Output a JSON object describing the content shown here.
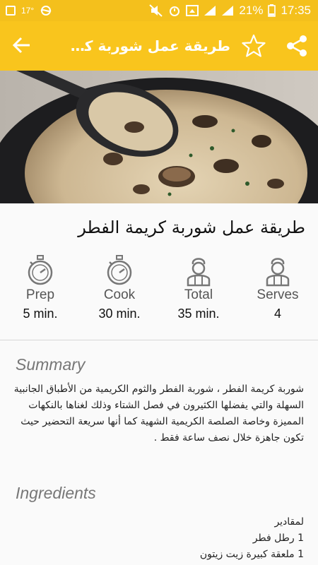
{
  "status_bar": {
    "weather_temp": "17°",
    "battery": "21%",
    "time": "17:35"
  },
  "toolbar": {
    "title": "طريقة عمل شوربة كريمة الفطر",
    "back_icon": "arrow-back-icon",
    "favorite_icon": "star-outline-icon",
    "share_icon": "share-icon"
  },
  "recipe": {
    "title": "طريقة عمل شوربة كريمة الفطر",
    "stats": [
      {
        "label": "Prep",
        "value": "5 min.",
        "icon": "stopwatch-icon"
      },
      {
        "label": "Cook",
        "value": "30 min.",
        "icon": "stopwatch-icon"
      },
      {
        "label": "Total",
        "value": "35 min.",
        "icon": "chef-icon"
      },
      {
        "label": "Serves",
        "value": "4",
        "icon": "chef-icon"
      }
    ],
    "summary_heading": "Summary",
    "summary_text": "شوربة كريمة الفطر ، شوربة الفطر والثوم الكريمية من الأطباق الجانبية السهلة والتي يفضلها الكثيرون في فصل الشتاء وذلك لغناها بالنكهات المميزة وخاصة الصلصة الكريمية الشهية كما أنها سريعة التحضير حيث تكون جاهزة خلال نصف ساعة فقط .",
    "ingredients_heading": "Ingredients",
    "ingredients": [
      "لمقادير",
      "1 رطل فطر",
      "1 ملعقة كبيرة زيت زيتون"
    ]
  },
  "colors": {
    "toolbar": "#f9c51d",
    "status_bar": "#f4c01c"
  }
}
